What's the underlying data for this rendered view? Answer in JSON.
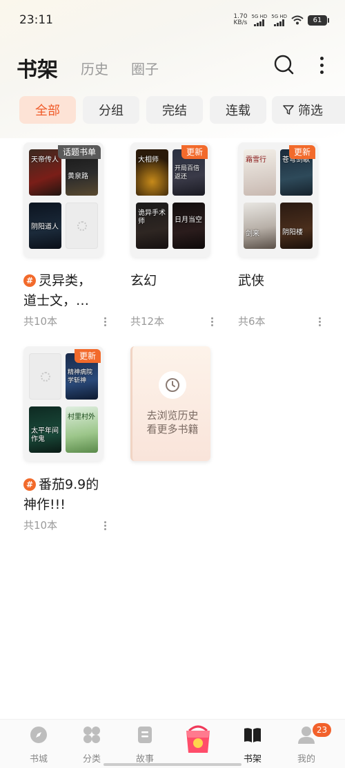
{
  "status_bar": {
    "time": "23:11",
    "speed_value": "1.70",
    "speed_unit": "KB/s",
    "signal1": "5G HD",
    "signal2": "5G HD",
    "battery": "61"
  },
  "header": {
    "tabs": [
      {
        "label": "书架",
        "active": true
      },
      {
        "label": "历史",
        "active": false
      },
      {
        "label": "圈子",
        "active": false
      }
    ]
  },
  "filters": {
    "chips": [
      {
        "label": "全部",
        "active": true
      },
      {
        "label": "分组",
        "active": false
      },
      {
        "label": "完结",
        "active": false
      },
      {
        "label": "连载",
        "active": false
      }
    ],
    "filter_label": "筛选"
  },
  "shelf": {
    "groups": [
      {
        "title": "灵异类，道士文，…",
        "title_line1": "灵异类，",
        "title_line2": "道士文，…",
        "topic": true,
        "badge": "话题书单",
        "count": "共10本",
        "books": [
          "天帝传人",
          "黄泉路",
          "阴阳道人",
          ""
        ]
      },
      {
        "title": "玄幻",
        "count": "共12本",
        "badge": "更新",
        "books": [
          "大相师",
          "开局百倍返还",
          "诡异手术师",
          "日月当空"
        ]
      },
      {
        "title": "武侠",
        "count": "共6本",
        "badge": "更新",
        "books": [
          "霜雪行",
          "苍穹剑歌",
          "剑来",
          "阴阳楼"
        ]
      },
      {
        "title_line1": "番茄9.9的",
        "title_line2": "神作!!!",
        "topic": true,
        "count": "共10本",
        "badge": "更新",
        "books": [
          "",
          "精神病院学斩神",
          "太平年间作鬼",
          "村里村外"
        ]
      }
    ],
    "history_card": {
      "line1": "去浏览历史",
      "line2": "看更多书籍"
    }
  },
  "bottom_nav": {
    "items": [
      {
        "label": "书城",
        "icon": "compass-icon"
      },
      {
        "label": "分类",
        "icon": "grid-icon"
      },
      {
        "label": "故事",
        "icon": "document-icon"
      },
      {
        "label": "",
        "icon": "gift-bag-icon"
      },
      {
        "label": "书架",
        "icon": "book-icon",
        "active": true
      },
      {
        "label": "我的",
        "icon": "profile-icon"
      }
    ],
    "badge": "23"
  },
  "colors": {
    "accent": "#f05a28",
    "chip_active_bg": "#fde3d6",
    "chip_bg": "#f1f1f1"
  }
}
